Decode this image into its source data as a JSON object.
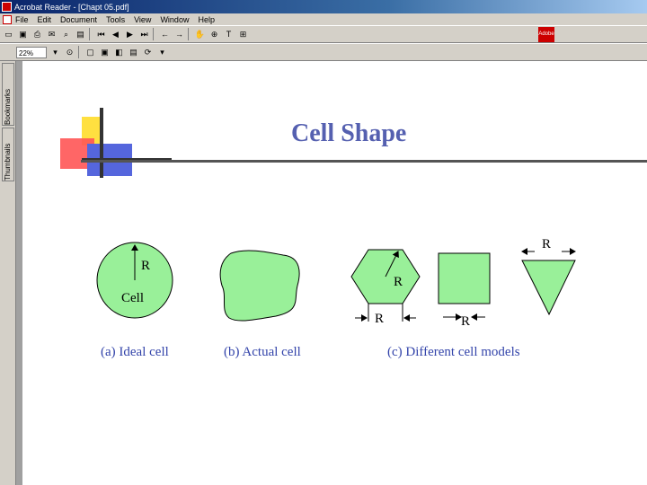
{
  "window": {
    "title": "Acrobat Reader - [Chapt 05.pdf]"
  },
  "menu": [
    "File",
    "Edit",
    "Document",
    "Tools",
    "View",
    "Window",
    "Help"
  ],
  "toolbar": {
    "zoom_value": "22%"
  },
  "nav_tabs": {
    "bookmarks": "Bookmarks",
    "thumbnails": "Thumbnails"
  },
  "slide": {
    "title": "Cell Shape",
    "captions": [
      "(a) Ideal cell",
      "(b) Actual cell",
      "(c) Different cell models"
    ],
    "ideal_labels": {
      "radius": "R",
      "center": "Cell"
    },
    "model_label": "R"
  },
  "colors": {
    "fill": "#99f099",
    "title": "#5560b0",
    "caption": "#3344aa"
  }
}
